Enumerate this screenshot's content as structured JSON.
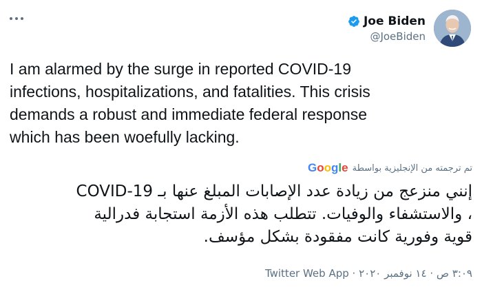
{
  "author": {
    "display_name": "Joe Biden",
    "handle": "@JoeBiden",
    "verified": true,
    "avatar_icon": "profile-photo"
  },
  "tweet": {
    "text": "I am alarmed by the surge in reported COVID-19\ninfections, hospitalizations, and fatalities. This crisis\ndemands a robust and immediate federal response\nwhich has been woefully lacking."
  },
  "translation": {
    "attribution": "تم ترجمته من الإنجليزية بواسطة",
    "provider": "Google",
    "text": "إنني منزعج من زيادة عدد الإصابات المبلغ عنها بـ COVID-19\n، والاستشفاء والوفيات. تتطلب هذه الأزمة استجابة فدرالية\nقوية وفورية كانت مفقودة بشكل مؤسف."
  },
  "meta": {
    "line": "٣:٠٩ ص · ١٤ نوفمبر ٢٠٢٠ · Twitter Web App"
  },
  "colors": {
    "verified": "#1d9bf0",
    "secondary_text": "#5b7083",
    "primary_text": "#0f1419"
  }
}
